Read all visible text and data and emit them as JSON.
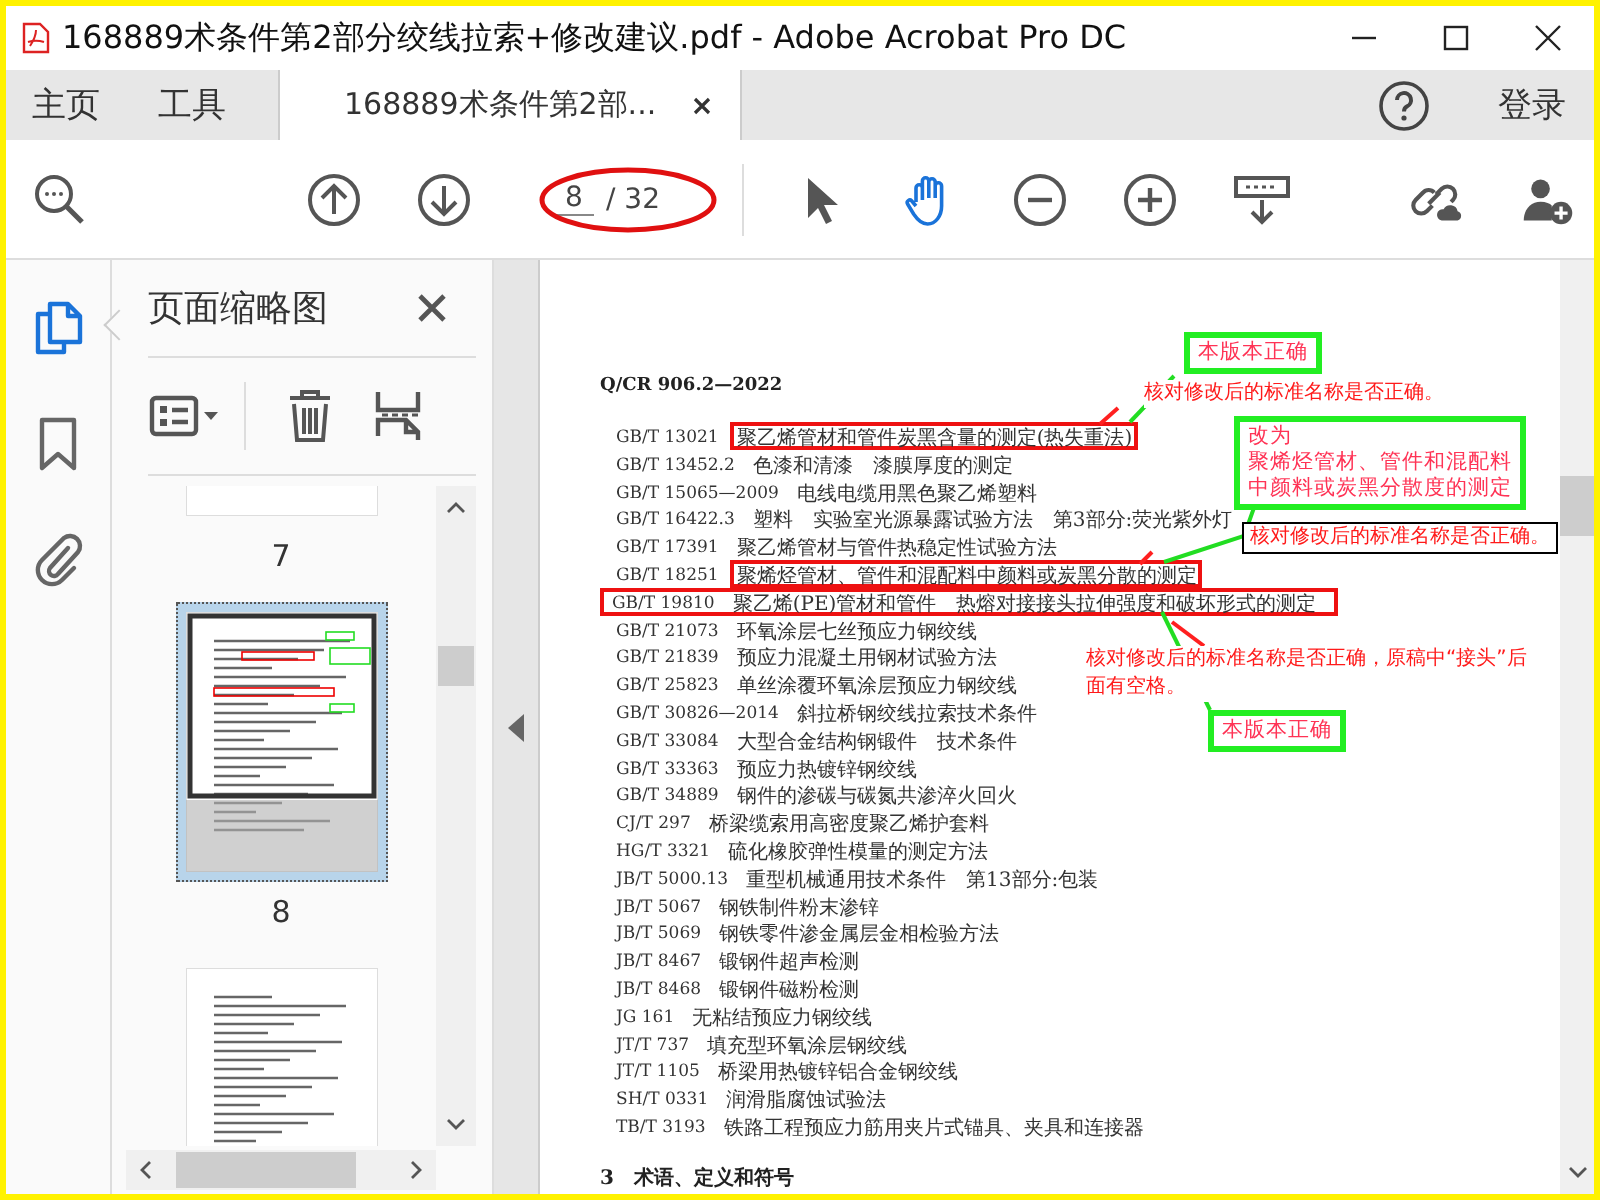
{
  "window": {
    "title": "168889术条件第2部分绞线拉索+修改建议.pdf - Adobe Acrobat Pro DC"
  },
  "tabs": [
    {
      "label": "主页",
      "selected": false,
      "closable": false
    },
    {
      "label": "工具",
      "selected": false,
      "closable": false
    },
    {
      "label": "168889术条件第2部...",
      "selected": true,
      "closable": true
    }
  ],
  "login": "登录",
  "toolbar": {
    "page_current": "8",
    "page_total": "/ 32",
    "select_tool_selected": false,
    "hand_tool_selected": true
  },
  "rail": [
    {
      "selected": true
    },
    {
      "selected": false
    },
    {
      "selected": false
    }
  ],
  "thumbnails": {
    "title": "页面缩略图",
    "pages": [
      {
        "label": "7",
        "selected": false
      },
      {
        "label": "8",
        "selected": true
      },
      {
        "selected": false
      }
    ]
  },
  "document": {
    "header": "Q/CR 906.2—2022",
    "references": [
      {
        "code": "GB/T 13021",
        "title": "聚乙烯管材和管件炭黑含量的测定(热失重法)",
        "title_boxed": true,
        "row_boxed": false
      },
      {
        "code": "GB/T 13452.2",
        "title": "色漆和清漆　漆膜厚度的测定",
        "title_boxed": false,
        "row_boxed": false
      },
      {
        "code": "GB/T 15065—2009",
        "title": "电线电缆用黑色聚乙烯塑料",
        "title_boxed": false,
        "row_boxed": false
      },
      {
        "code": "GB/T 16422.3",
        "title": "塑料　实验室光源暴露试验方法　第3部分:荧光紫外灯",
        "title_boxed": false,
        "row_boxed": false
      },
      {
        "code": "GB/T 17391",
        "title": "聚乙烯管材与管件热稳定性试验方法",
        "title_boxed": false,
        "row_boxed": false
      },
      {
        "code": "GB/T 18251",
        "title": "聚烯烃管材、管件和混配料中颜料或炭黑分散的测定",
        "title_boxed": true,
        "row_boxed": false
      },
      {
        "code": "GB/T 19810",
        "title": "聚乙烯(PE)管材和管件　热熔对接接头拉伸强度和破坏形式的测定",
        "title_boxed": false,
        "row_boxed": true
      },
      {
        "code": "GB/T 21073",
        "title": "环氧涂层七丝预应力钢绞线",
        "title_boxed": false,
        "row_boxed": false
      },
      {
        "code": "GB/T 21839",
        "title": "预应力混凝土用钢材试验方法",
        "title_boxed": false,
        "row_boxed": false
      },
      {
        "code": "GB/T 25823",
        "title": "单丝涂覆环氧涂层预应力钢绞线",
        "title_boxed": false,
        "row_boxed": false
      },
      {
        "code": "GB/T 30826—2014",
        "title": "斜拉桥钢绞线拉索技术条件",
        "title_boxed": false,
        "row_boxed": false
      },
      {
        "code": "GB/T 33084",
        "title": "大型合金结构钢锻件　技术条件",
        "title_boxed": false,
        "row_boxed": false
      },
      {
        "code": "GB/T 33363",
        "title": "预应力热镀锌钢绞线",
        "title_boxed": false,
        "row_boxed": false
      },
      {
        "code": "GB/T 34889",
        "title": "钢件的渗碳与碳氮共渗淬火回火",
        "title_boxed": false,
        "row_boxed": false
      },
      {
        "code": "CJ/T 297",
        "title": "桥梁缆索用高密度聚乙烯护套料",
        "title_boxed": false,
        "row_boxed": false
      },
      {
        "code": "HG/T 3321",
        "title": "硫化橡胶弹性模量的测定方法",
        "title_boxed": false,
        "row_boxed": false
      },
      {
        "code": "JB/T 5000.13",
        "title": "重型机械通用技术条件　第13部分:包装",
        "title_boxed": false,
        "row_boxed": false
      },
      {
        "code": "JB/T 5067",
        "title": "钢铁制件粉末渗锌",
        "title_boxed": false,
        "row_boxed": false
      },
      {
        "code": "JB/T 5069",
        "title": "钢铁零件渗金属层金相检验方法",
        "title_boxed": false,
        "row_boxed": false
      },
      {
        "code": "JB/T 8467",
        "title": "锻钢件超声检测",
        "title_boxed": false,
        "row_boxed": false
      },
      {
        "code": "JB/T 8468",
        "title": "锻钢件磁粉检测",
        "title_boxed": false,
        "row_boxed": false
      },
      {
        "code": "JG 161",
        "title": "无粘结预应力钢绞线",
        "title_boxed": false,
        "row_boxed": false
      },
      {
        "code": "JT/T 737",
        "title": "填充型环氧涂层钢绞线",
        "title_boxed": false,
        "row_boxed": false
      },
      {
        "code": "JT/T 1105",
        "title": "桥梁用热镀锌铝合金钢绞线",
        "title_boxed": false,
        "row_boxed": false
      },
      {
        "code": "SH/T 0331",
        "title": "润滑脂腐蚀试验法",
        "title_boxed": false,
        "row_boxed": false
      },
      {
        "code": "TB/T 3193",
        "title": "铁路工程预应力筋用夹片式锚具、夹具和连接器",
        "title_boxed": false,
        "row_boxed": false
      }
    ],
    "section": "3　术语、定义和符号"
  },
  "annotations": [
    {
      "kind": "callout",
      "lines": [
        "本版本正确"
      ]
    },
    {
      "kind": "comment",
      "text": "核对修改后的标准名称是否正确。",
      "boxed": false
    },
    {
      "kind": "callout",
      "lines": [
        "改为",
        "聚烯烃管材、管件和混配料",
        "中颜料或炭黑分散度的测定"
      ]
    },
    {
      "kind": "comment",
      "text": "核对修改后的标准名称是否正确。",
      "boxed": true
    },
    {
      "kind": "comment",
      "text": "核对修改后的标准名称是否正确，原稿中“接头”后面有空格。",
      "boxed": false
    },
    {
      "kind": "callout",
      "lines": [
        "本版本正确"
      ]
    }
  ]
}
